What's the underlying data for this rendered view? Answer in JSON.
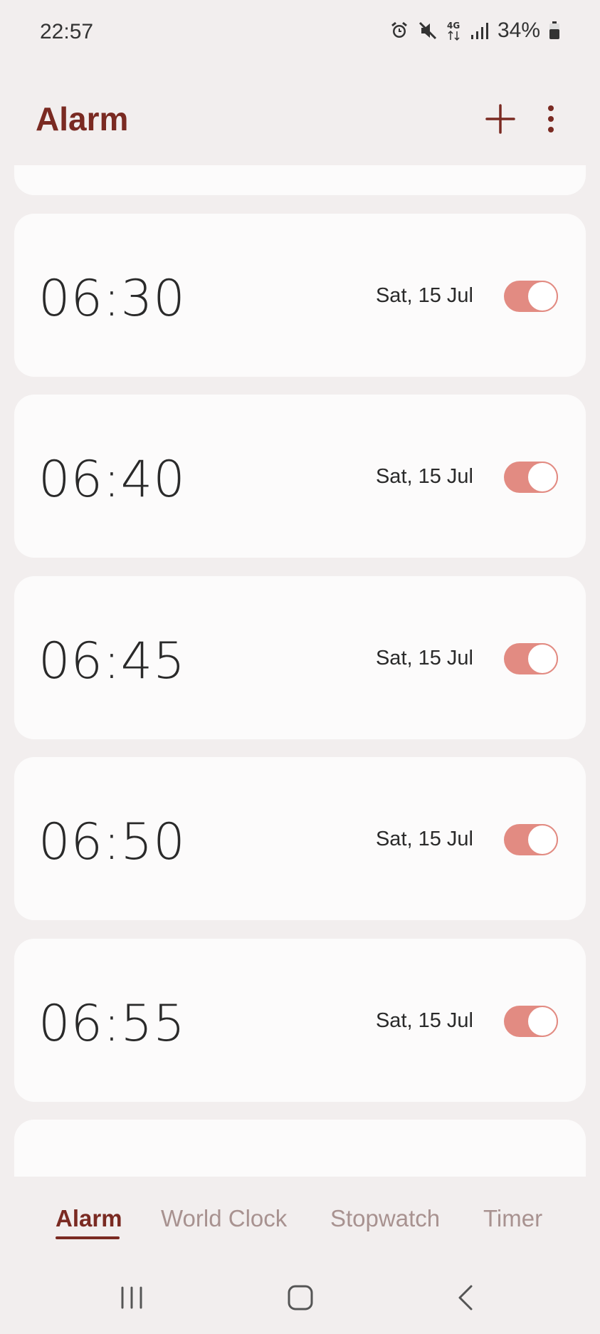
{
  "status": {
    "time": "22:57",
    "battery": "34%",
    "network": "4G"
  },
  "header": {
    "title": "Alarm"
  },
  "alarms": [
    {
      "time": "06:30",
      "date": "Sat, 15 Jul",
      "enabled": true
    },
    {
      "time": "06:40",
      "date": "Sat, 15 Jul",
      "enabled": true
    },
    {
      "time": "06:45",
      "date": "Sat, 15 Jul",
      "enabled": true
    },
    {
      "time": "06:50",
      "date": "Sat, 15 Jul",
      "enabled": true
    },
    {
      "time": "06:55",
      "date": "Sat, 15 Jul",
      "enabled": true
    }
  ],
  "tabs": [
    {
      "label": "Alarm",
      "active": true
    },
    {
      "label": "World Clock",
      "active": false
    },
    {
      "label": "Stopwatch",
      "active": false
    },
    {
      "label": "Timer",
      "active": false
    }
  ],
  "colors": {
    "accent": "#7a2a22",
    "toggle_on": "#e28b82",
    "background": "#f2eeee",
    "card": "#fcfbfb"
  },
  "icons": [
    "alarm-icon",
    "mute-icon",
    "data-4g-icon",
    "signal-icon",
    "battery-icon",
    "add-icon",
    "more-vert-icon",
    "recents-icon",
    "home-icon",
    "back-icon"
  ]
}
